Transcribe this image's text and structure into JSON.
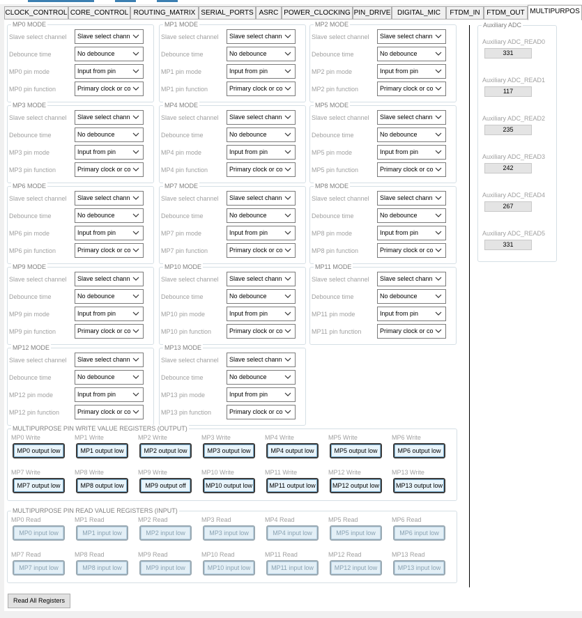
{
  "tabs": [
    {
      "label": "CLOCK_CONTROL",
      "active": false
    },
    {
      "label": "CORE_CONTROL",
      "active": false
    },
    {
      "label": "ROUTING_MATRIX",
      "active": false
    },
    {
      "label": "SERIAL_PORTS",
      "active": false
    },
    {
      "label": "ASRC",
      "active": false
    },
    {
      "label": "POWER_CLOCKING",
      "active": false
    },
    {
      "label": "PIN_DRIVE",
      "active": false
    },
    {
      "label": "DIGITAL_MIC",
      "active": false
    },
    {
      "label": "FTDM_IN",
      "active": false
    },
    {
      "label": "FTDM_OUT",
      "active": false
    },
    {
      "label": "MULTIPURPOS",
      "active": true
    }
  ],
  "mp_modes": [
    {
      "title": "MP0 MODE",
      "labels": [
        "Slave select channel",
        "Debounce time",
        "MP0 pin mode",
        "MP0 pin function"
      ],
      "values": [
        "Slave select chann",
        "No debounce",
        "Input from pin",
        "Primary clock or co"
      ]
    },
    {
      "title": "MP1 MODE",
      "labels": [
        "Slave select channel",
        "Debounce time",
        "MP1 pin mode",
        "MP1 pin function"
      ],
      "values": [
        "Slave select chann",
        "No debounce",
        "Input from pin",
        "Primary clock or co"
      ]
    },
    {
      "title": "MP2 MODE",
      "labels": [
        "Slave select channel",
        "Debounce time",
        "MP2 pin mode",
        "MP2 pin function"
      ],
      "values": [
        "Slave select chann",
        "No debounce",
        "Input from pin",
        "Primary clock or co"
      ]
    },
    {
      "title": "MP3 MODE",
      "labels": [
        "Slave select channel",
        "Debounce time",
        "MP3 pin mode",
        "MP3 pin function"
      ],
      "values": [
        "Slave select chann",
        "No debounce",
        "Input from pin",
        "Primary clock or co"
      ]
    },
    {
      "title": "MP4 MODE",
      "labels": [
        "Slave select channel",
        "Debounce time",
        "MP4 pin mode",
        "MP4 pin function"
      ],
      "values": [
        "Slave select chann",
        "No debounce",
        "Input from pin",
        "Primary clock or co"
      ]
    },
    {
      "title": "MP5 MODE",
      "labels": [
        "Slave select channel",
        "Debounce time",
        "MP5 pin mode",
        "MP5 pin function"
      ],
      "values": [
        "Slave select chann",
        "No debounce",
        "Input from pin",
        "Primary clock or co"
      ]
    },
    {
      "title": "MP6 MODE",
      "labels": [
        "Slave select channel",
        "Debounce time",
        "MP6 pin mode",
        "MP6 pin function"
      ],
      "values": [
        "Slave select chann",
        "No debounce",
        "Input from pin",
        "Primary clock or co"
      ]
    },
    {
      "title": "MP7 MODE",
      "labels": [
        "Slave select channel",
        "Debounce time",
        "MP7 pin mode",
        "MP7 pin function"
      ],
      "values": [
        "Slave select chann",
        "No debounce",
        "Input from pin",
        "Primary clock or co"
      ]
    },
    {
      "title": "MP8 MODE",
      "labels": [
        "Slave select channel",
        "Debounce time",
        "MP8 pin mode",
        "MP8 pin function"
      ],
      "values": [
        "Slave select chann",
        "No debounce",
        "Input from pin",
        "Primary clock or co"
      ]
    },
    {
      "title": "MP9 MODE",
      "labels": [
        "Slave select channel",
        "Debounce time",
        "MP9 pin mode",
        "MP9 pin function"
      ],
      "values": [
        "Slave select chann",
        "No debounce",
        "Input from pin",
        "Primary clock or co"
      ]
    },
    {
      "title": "MP10 MODE",
      "labels": [
        "Slave select channel",
        "Debounce time",
        "MP10 pin mode",
        "MP10 pin function"
      ],
      "values": [
        "Slave select chann",
        "No debounce",
        "Input from pin",
        "Primary clock or co"
      ]
    },
    {
      "title": "MP11 MODE",
      "labels": [
        "Slave select channel",
        "Debounce time",
        "MP11 pin mode",
        "MP11 pin function"
      ],
      "values": [
        "Slave select chann",
        "No debounce",
        "Input from pin",
        "Primary clock or co"
      ]
    },
    {
      "title": "MP12 MODE",
      "labels": [
        "Slave select channel",
        "Debounce time",
        "MP12 pin mode",
        "MP12 pin function"
      ],
      "values": [
        "Slave select chann",
        "No debounce",
        "Input from pin",
        "Primary clock or co"
      ]
    },
    {
      "title": "MP13 MODE",
      "labels": [
        "Slave select channel",
        "Debounce time",
        "MP13 pin mode",
        "MP13 pin function"
      ],
      "values": [
        "Slave select chann",
        "No debounce",
        "Input from pin",
        "Primary clock or co"
      ]
    }
  ],
  "write_group": {
    "title": "MULTIPURPOSE PIN WRITE VALUE REGISTERS (OUTPUT)",
    "items": [
      {
        "label": "MP0 Write",
        "button": "MP0 output low"
      },
      {
        "label": "MP1 Write",
        "button": "MP1 output low"
      },
      {
        "label": "MP2 Write",
        "button": "MP2 output low"
      },
      {
        "label": "MP3 Write",
        "button": "MP3 output low"
      },
      {
        "label": "MP4 Write",
        "button": "MP4 output low"
      },
      {
        "label": "MP5 Write",
        "button": "MP5 output low"
      },
      {
        "label": "MP6 Write",
        "button": "MP6 output low"
      },
      {
        "label": "MP7 Write",
        "button": "MP7 output low"
      },
      {
        "label": "MP8 Write",
        "button": "MP8 output low"
      },
      {
        "label": "MP9 Write",
        "button": "MP9 output off"
      },
      {
        "label": "MP10 Write",
        "button": "MP10 output low"
      },
      {
        "label": "MP11 Write",
        "button": "MP11 output low"
      },
      {
        "label": "MP12 Write",
        "button": "MP12 output low"
      },
      {
        "label": "MP13 Write",
        "button": "MP13 output low"
      }
    ]
  },
  "read_group": {
    "title": "MULTIPURPOSE PIN READ VALUE REGISTERS (INPUT)",
    "items": [
      {
        "label": "MP0 Read",
        "button": "MP0 input low"
      },
      {
        "label": "MP1 Read",
        "button": "MP1 input low"
      },
      {
        "label": "MP2 Read",
        "button": "MP2 input low"
      },
      {
        "label": "MP3 Read",
        "button": "MP3 input low"
      },
      {
        "label": "MP4 Read",
        "button": "MP4 input low"
      },
      {
        "label": "MP5 Read",
        "button": "MP5 input low"
      },
      {
        "label": "MP6 Read",
        "button": "MP6 input low"
      },
      {
        "label": "MP7 Read",
        "button": "MP7 input low"
      },
      {
        "label": "MP8 Read",
        "button": "MP8 input low"
      },
      {
        "label": "MP9 Read",
        "button": "MP9 input low"
      },
      {
        "label": "MP10 Read",
        "button": "MP10 input low"
      },
      {
        "label": "MP11 Read",
        "button": "MP11 input low"
      },
      {
        "label": "MP12 Read",
        "button": "MP12 input low"
      },
      {
        "label": "MP13 Read",
        "button": "MP13 input low"
      }
    ]
  },
  "aux_adc": {
    "title": "Auxiliary ADC",
    "reads": [
      {
        "label": "Auxiliary ADC_READ0",
        "value": "331"
      },
      {
        "label": "Auxiliary ADC_READ1",
        "value": "117"
      },
      {
        "label": "Auxiliary ADC_READ2",
        "value": "235"
      },
      {
        "label": "Auxiliary ADC_READ3",
        "value": "242"
      },
      {
        "label": "Auxiliary ADC_READ4",
        "value": "267"
      },
      {
        "label": "Auxiliary ADC_READ5",
        "value": "331"
      }
    ]
  },
  "read_all_label": "Read All Registers",
  "colors": {
    "accent_strip": "#3c7fb1",
    "write_button_border": "#3a3a3a",
    "read_button_text": "#8aa2b2"
  }
}
